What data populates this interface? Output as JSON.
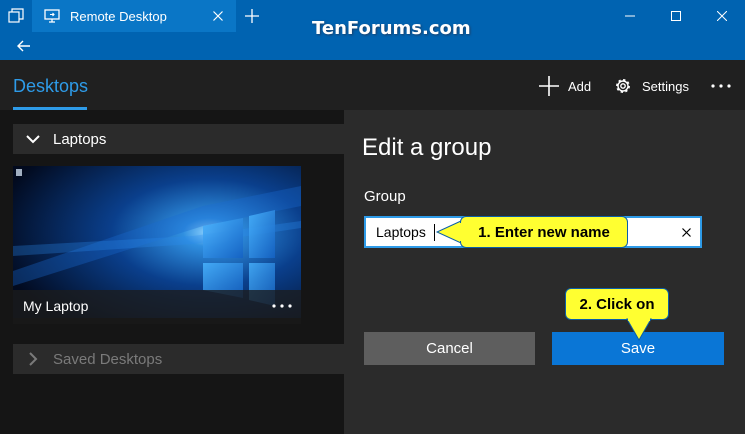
{
  "window": {
    "tab_title": "Remote Desktop",
    "watermark": "TenForums.com"
  },
  "appbar": {
    "section_title": "Desktops",
    "add_label": "Add",
    "settings_label": "Settings"
  },
  "groups": [
    {
      "label": "Laptops",
      "expanded": true
    },
    {
      "label": "Saved Desktops",
      "expanded": false
    }
  ],
  "desktop_tile": {
    "name": "My Laptop"
  },
  "edit_group": {
    "title": "Edit a group",
    "field_label": "Group",
    "field_value": "Laptops",
    "cancel_label": "Cancel",
    "save_label": "Save"
  },
  "callouts": {
    "step1": "1. Enter new name",
    "step2": "2. Click on"
  },
  "colors": {
    "accent": "#0063b1",
    "selected_blue": "#2e9be8",
    "callout_yellow": "#ffff31",
    "button_save": "#0a76d6",
    "button_cancel": "#5e5e5e"
  }
}
